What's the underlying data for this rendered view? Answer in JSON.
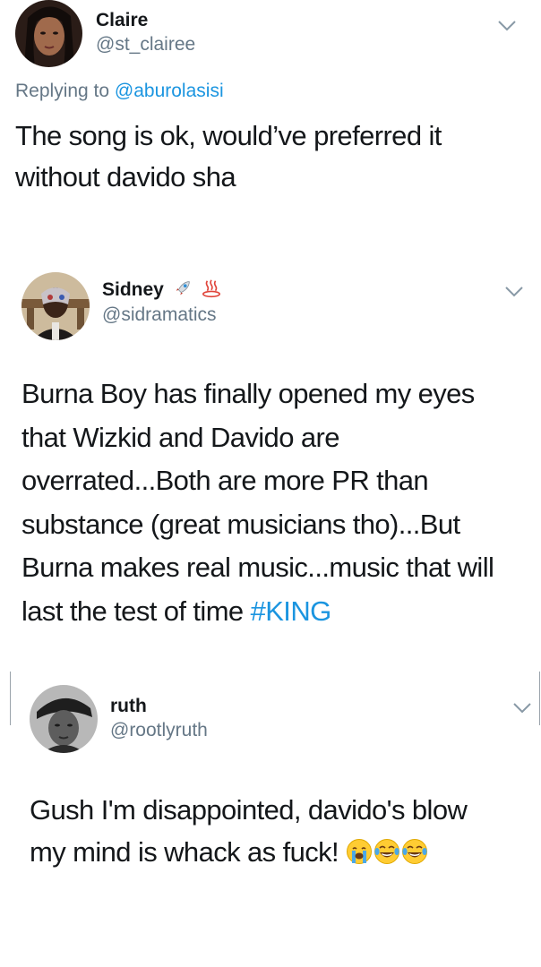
{
  "tweets": [
    {
      "name": "Claire",
      "handle": "@st_clairee",
      "replying_prefix": "Replying to ",
      "replying_to": "@aburolasisi",
      "lines": [
        "The song is ok, would’ve preferred it",
        "without davido sha"
      ]
    },
    {
      "name": "Sidney",
      "handle": "@sidramatics",
      "name_emojis": [
        "rocket-emoji",
        "hot-springs-emoji"
      ],
      "lines": [
        "Burna Boy has finally opened my eyes",
        "that Wizkid and Davido are",
        "overrated...Both are more PR than",
        "substance (great musicians tho)...But",
        "Burna makes real music...music that will"
      ],
      "last_line_text": "last the test of time ",
      "hashtag": "#KING"
    },
    {
      "name": "ruth",
      "handle": "@rootlyruth",
      "lines": [
        "Gush I'm disappointed,  davido's blow"
      ],
      "last_line_text": "my mind is whack as fuck! ",
      "emojis": [
        "loudly-crying-face-emoji",
        "face-with-tears-of-joy-emoji",
        "face-with-tears-of-joy-emoji"
      ]
    }
  ],
  "colors": {
    "text": "#14171a",
    "secondary": "#657786",
    "link": "#1b95e0",
    "background": "#ffffff"
  }
}
